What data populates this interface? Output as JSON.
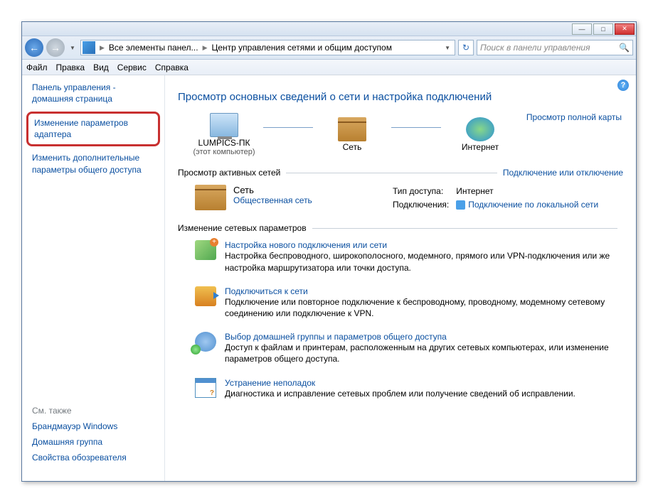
{
  "window": {
    "minimize": "—",
    "maximize": "□",
    "close": "✕"
  },
  "nav": {
    "back": "←",
    "forward": "→",
    "dropdown": "▼"
  },
  "breadcrumb": {
    "item1": "Все элементы панел...",
    "item2": "Центр управления сетями и общим доступом",
    "sep": "▶"
  },
  "refresh": "↻",
  "search": {
    "placeholder": "Поиск в панели управления",
    "icon": "🔍"
  },
  "menubar": {
    "file": "Файл",
    "edit": "Правка",
    "view": "Вид",
    "tools": "Сервис",
    "help": "Справка"
  },
  "sidebar": {
    "home": "Панель управления - домашняя страница",
    "adapter": "Изменение параметров адаптера",
    "sharing": "Изменить дополнительные параметры общего доступа",
    "seealso_label": "См. также",
    "firewall": "Брандмауэр Windows",
    "homegroup": "Домашняя группа",
    "internet_options": "Свойства обозревателя"
  },
  "help_icon": "?",
  "page_title": "Просмотр основных сведений о сети и настройка подключений",
  "netmap": {
    "node1_label": "LUMPICS-ПК",
    "node1_sub": "(этот компьютер)",
    "node2_label": "Сеть",
    "node3_label": "Интернет",
    "fullmap_link": "Просмотр полной карты"
  },
  "active": {
    "header": "Просмотр активных сетей",
    "header_link": "Подключение или отключение",
    "net_name": "Сеть",
    "net_type": "Общественная сеть",
    "access_label": "Тип доступа:",
    "access_value": "Интернет",
    "conn_label": "Подключения:",
    "conn_value": "Подключение по локальной сети"
  },
  "change": {
    "header": "Изменение сетевых параметров"
  },
  "tasks": [
    {
      "title": "Настройка нового подключения или сети",
      "desc": "Настройка беспроводного, широкополосного, модемного, прямого или VPN-подключения или же настройка маршрутизатора или точки доступа."
    },
    {
      "title": "Подключиться к сети",
      "desc": "Подключение или повторное подключение к беспроводному, проводному, модемному сетевому соединению или подключение к VPN."
    },
    {
      "title": "Выбор домашней группы и параметров общего доступа",
      "desc": "Доступ к файлам и принтерам, расположенным на других сетевых компьютерах, или изменение параметров общего доступа."
    },
    {
      "title": "Устранение неполадок",
      "desc": "Диагностика и исправление сетевых проблем или получение сведений об исправлении."
    }
  ]
}
